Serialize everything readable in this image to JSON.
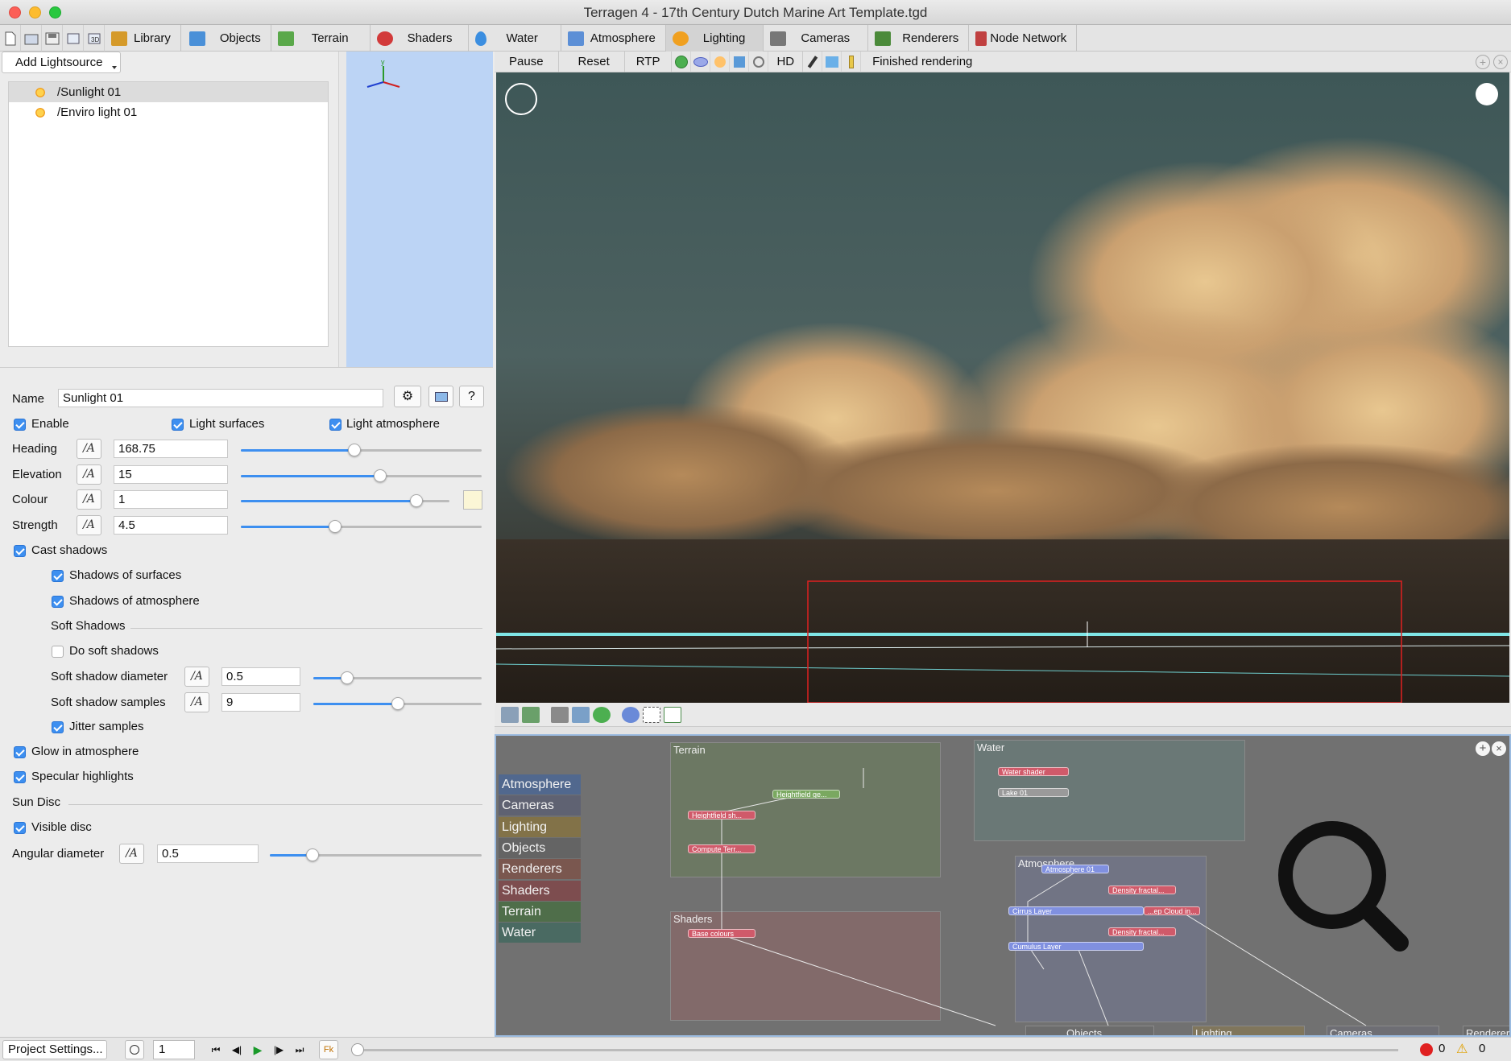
{
  "window": {
    "title": "Terragen 4 - 17th Century Dutch Marine Art Template.tgd"
  },
  "tabs": [
    {
      "label": "Library",
      "color": "#d59a2a"
    },
    {
      "label": "Objects",
      "color": "#4a90d8"
    },
    {
      "label": "Terrain",
      "color": "#5aa84a"
    },
    {
      "label": "Shaders",
      "color": "#d23a3a"
    },
    {
      "label": "Water",
      "color": "#3b8ee0"
    },
    {
      "label": "Atmosphere",
      "color": "#5c8fd6"
    },
    {
      "label": "Lighting",
      "color": "#f0a020"
    },
    {
      "label": "Cameras",
      "color": "#777777"
    },
    {
      "label": "Renderers",
      "color": "#4b8a3a"
    },
    {
      "label": "Node Network",
      "color": "#c04040"
    }
  ],
  "lighting": {
    "add_lightsource": "Add Lightsource",
    "tree": [
      "/Sunlight 01",
      "/Enviro light 01"
    ],
    "name_label": "Name",
    "name_value": "Sunlight 01",
    "enable": "Enable",
    "light_surfaces": "Light surfaces",
    "light_atmosphere": "Light atmosphere",
    "heading_label": "Heading",
    "heading_value": "168.75",
    "heading_level": 0.47,
    "elevation_label": "Elevation",
    "elevation_value": "15",
    "elevation_level": 0.58,
    "colour_label": "Colour",
    "colour_value": "1",
    "colour_level": 0.84,
    "strength_label": "Strength",
    "strength_value": "4.5",
    "strength_level": 0.39,
    "cast_shadows": "Cast shadows",
    "shadows_surfaces": "Shadows of surfaces",
    "shadows_atmosphere": "Shadows of atmosphere",
    "soft_shadows_header": "Soft Shadows",
    "do_soft_shadows": "Do soft shadows",
    "soft_diameter_label": "Soft shadow diameter",
    "soft_diameter_value": "0.5",
    "soft_diameter_level": 0.2,
    "soft_samples_label": "Soft shadow samples",
    "soft_samples_value": "9",
    "soft_samples_level": 0.5,
    "jitter_samples": "Jitter samples",
    "glow_atmosphere": "Glow in atmosphere",
    "specular_highlights": "Specular highlights",
    "sun_disc_header": "Sun Disc",
    "visible_disc": "Visible disc",
    "angular_label": "Angular diameter",
    "angular_value": "0.5",
    "angular_level": 0.2,
    "help": "?"
  },
  "render_toolbar": {
    "pause": "Pause",
    "reset": "Reset",
    "rtp": "RTP",
    "hd": "HD",
    "status": "Finished rendering"
  },
  "node_network": {
    "categories": [
      {
        "label": "Atmosphere",
        "color": "#51688e"
      },
      {
        "label": "Cameras",
        "color": "#5f6272"
      },
      {
        "label": "Lighting",
        "color": "#827248"
      },
      {
        "label": "Objects",
        "color": "#646464"
      },
      {
        "label": "Renderers",
        "color": "#7a574f"
      },
      {
        "label": "Shaders",
        "color": "#7d4d4f"
      },
      {
        "label": "Terrain",
        "color": "#4f6e4a"
      },
      {
        "label": "Water",
        "color": "#4a6a62"
      }
    ],
    "groups": {
      "terrain": "Terrain",
      "water": "Water",
      "shaders": "Shaders",
      "atmosphere": "Atmosphere",
      "objects": "Objects",
      "lighting": "Lighting",
      "cameras": "Cameras",
      "renderers": "Renderers"
    },
    "nodes": {
      "heightfield_ge": "Heightfield ge...",
      "heightfield_sh": "Heightfield sh...",
      "compute_terr": "Compute Terr...",
      "water_shader": "Water shader",
      "lake": "Lake 01",
      "base_colours": "Base colours",
      "atmosphere01": "Atmosphere 01",
      "density_fractal1": "Density fractal...",
      "cirrus_layer": "Cirrus Layer",
      "cloud_in": "...ep Cloud in...",
      "density_fractal2": "Density fractal...",
      "cumulus_layer": "Cumulus Layer"
    }
  },
  "bottom": {
    "project_settings": "Project Settings...",
    "frame": "1",
    "errors": "0",
    "warnings": "0"
  }
}
